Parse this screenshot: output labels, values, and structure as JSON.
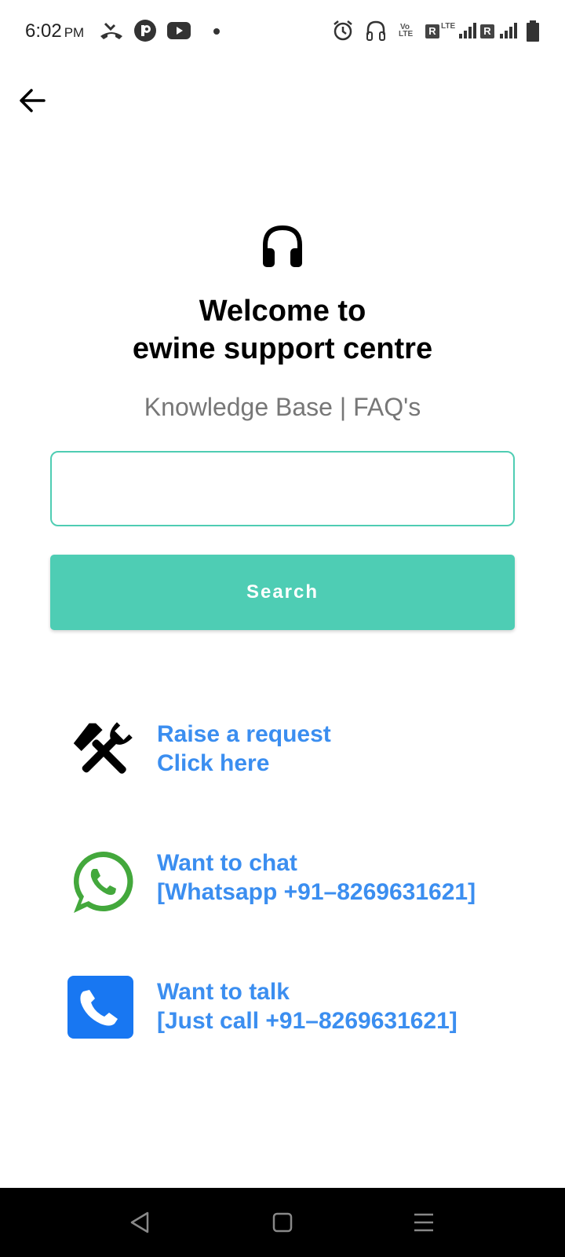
{
  "status_bar": {
    "time": "6:02",
    "ampm": "PM",
    "volte": "Vo LTE",
    "lte": "LTE",
    "roaming_1": "R",
    "roaming_2": "R"
  },
  "welcome": {
    "line1": "Welcome to",
    "line2": "ewine support centre",
    "subtitle": "Knowledge Base | FAQ's"
  },
  "search": {
    "value": "",
    "placeholder": "",
    "button_label": "Search"
  },
  "actions": [
    {
      "icon": "tools-icon",
      "line1": "Raise a request",
      "line2": "Click here"
    },
    {
      "icon": "whatsapp-icon",
      "line1": "Want to chat",
      "line2": "[Whatsapp +91–8269631621]"
    },
    {
      "icon": "phone-icon",
      "line1": "Want to talk",
      "line2": "[Just call +91–8269631621]"
    }
  ],
  "colors": {
    "accent": "#4ecdb4",
    "link": "#3b8ef0",
    "whatsapp": "#43a83c",
    "phone": "#1877f2"
  }
}
